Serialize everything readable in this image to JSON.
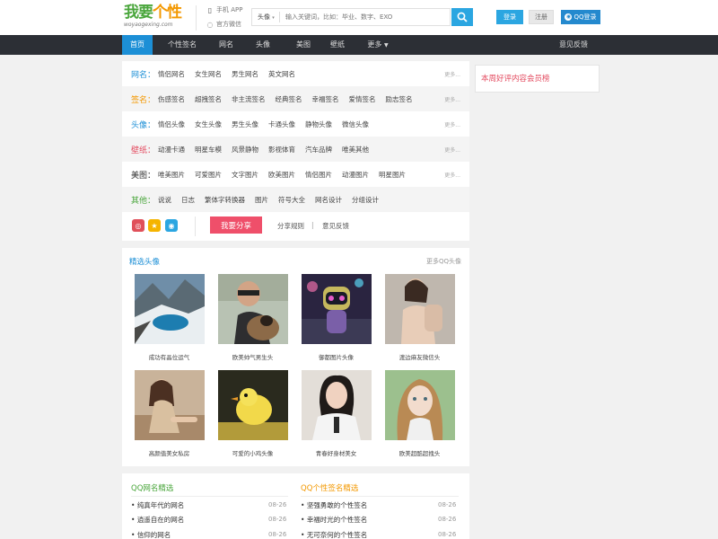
{
  "header": {
    "logo_main_green": "我要",
    "logo_main_orange": "个性",
    "logo_sub": "woyaogexing.com",
    "app_link": "手机 APP",
    "wechat_link": "官方微信",
    "search_category": "头像",
    "search_placeholder": "输入关键词，比如：毕业、数字、EXO",
    "login_label": "登录",
    "register_label": "注册",
    "qq_login_label": "QQ登录"
  },
  "nav": {
    "items": [
      "首页",
      "个性签名",
      "网名",
      "头像",
      "美图",
      "壁纸",
      "更多"
    ],
    "feedback": "意见反馈"
  },
  "categories": [
    {
      "title": "网名：",
      "color": "#1c8fd6",
      "links": [
        "情侣网名",
        "女生网名",
        "男生网名",
        "英文网名"
      ],
      "more": "更多..."
    },
    {
      "title": "签名：",
      "color": "#f39800",
      "links": [
        "伤感签名",
        "超拽签名",
        "非主流签名",
        "经典签名",
        "幸福签名",
        "爱情签名",
        "励志签名"
      ],
      "more": "更多..."
    },
    {
      "title": "头像：",
      "color": "#1c8fd6",
      "links": [
        "情侣头像",
        "女生头像",
        "男生头像",
        "卡通头像",
        "静物头像",
        "微信头像"
      ],
      "more": "更多..."
    },
    {
      "title": "壁纸：",
      "color": "#e3495e",
      "links": [
        "动漫卡通",
        "明星车模",
        "风景静物",
        "影视体育",
        "汽车品牌",
        "唯美其他"
      ],
      "more": "更多..."
    },
    {
      "title": "美图：",
      "color": "#333333",
      "links": [
        "唯美图片",
        "可爱图片",
        "文字图片",
        "欧美图片",
        "情侣图片",
        "动漫图片",
        "明星图片"
      ],
      "more": "更多..."
    },
    {
      "title": "其他：",
      "color": "#4aa63c",
      "links": [
        "说说",
        "日志",
        "繁体字转换器",
        "图片",
        "符号大全",
        "网名设计",
        "分组设计"
      ],
      "more": ""
    }
  ],
  "share": {
    "button": "我要分享",
    "rules": "分享规则",
    "divider": "|",
    "feedback": "意见反馈"
  },
  "right_box": {
    "title": "本周好评内容会员榜"
  },
  "avatars": {
    "title": "精选头像",
    "more": "更多QQ头像",
    "items": [
      {
        "caption": "成功有晶位运气"
      },
      {
        "caption": "欧美帅气男生头"
      },
      {
        "caption": "御都图片头像"
      },
      {
        "caption": "渡边麻友微信头"
      },
      {
        "caption": "高颜值美女私房"
      },
      {
        "caption": "可爱的小鸡头像"
      },
      {
        "caption": "青春好身材美女"
      },
      {
        "caption": "欧美超酷超拽头"
      }
    ]
  },
  "lists": {
    "left_title": "QQ网名精选",
    "left_items": [
      {
        "text": "纯真年代的网名",
        "date": "08-26"
      },
      {
        "text": "逍遥自在的网名",
        "date": "08-26"
      },
      {
        "text": "信仰的网名",
        "date": "08-26"
      }
    ],
    "right_title": "QQ个性签名精选",
    "right_items": [
      {
        "text": "坚强勇敢的个性签名",
        "date": "08-26"
      },
      {
        "text": "幸福时光的个性签名",
        "date": "08-26"
      },
      {
        "text": "无可奈何的个性签名",
        "date": "08-26"
      }
    ]
  },
  "colors": {
    "accent": "#1c8fd6",
    "share_red": "#ef4f6a",
    "nav_bg": "#2c2f35"
  }
}
